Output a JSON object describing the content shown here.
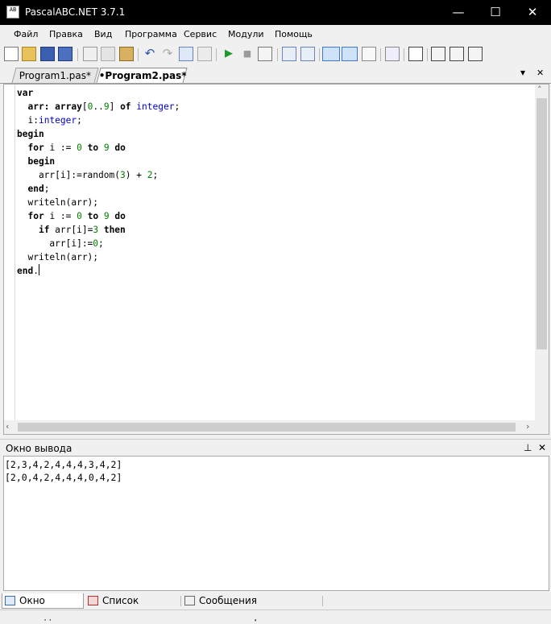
{
  "window": {
    "title": "PascalABC.NET 3.7.1",
    "icon_text": "AB"
  },
  "controls": {
    "minimize": "—",
    "maximize": "☐",
    "close": "✕"
  },
  "menu": [
    "Файл",
    "Правка",
    "Вид",
    "Программа",
    "Сервис",
    "Модули",
    "Помощь"
  ],
  "tabs": [
    {
      "label": "Program1.pas*",
      "active": false
    },
    {
      "label": "•Program2.pas*",
      "active": true
    }
  ],
  "tab_controls": {
    "dropdown": "▾",
    "close": "✕"
  },
  "code_lines": [
    "var",
    "  arr: array[0..9] of integer;",
    "  i:integer;",
    "begin",
    "  for i := 0 to 9 do",
    "  begin",
    "    arr[i]:=random(3) + 2;",
    "  end;",
    "  writeln(arr);",
    "  for i := 0 to 9 do",
    "    if arr[i]=3 then",
    "      arr[i]:=0;",
    "  writeln(arr);",
    "end."
  ],
  "output": {
    "title": "Окно вывода",
    "pin": "⊥",
    "close": "✕",
    "lines": [
      "[2,3,4,2,4,4,4,3,4,2]",
      "[2,0,4,2,4,4,4,0,4,2]"
    ]
  },
  "bottom_tabs": [
    "Окно вывода",
    "Список ошибок",
    "Сообщения компилятора"
  ],
  "colors": {
    "keyword": "#000000",
    "type": "#0000c8",
    "number": "#008000"
  }
}
